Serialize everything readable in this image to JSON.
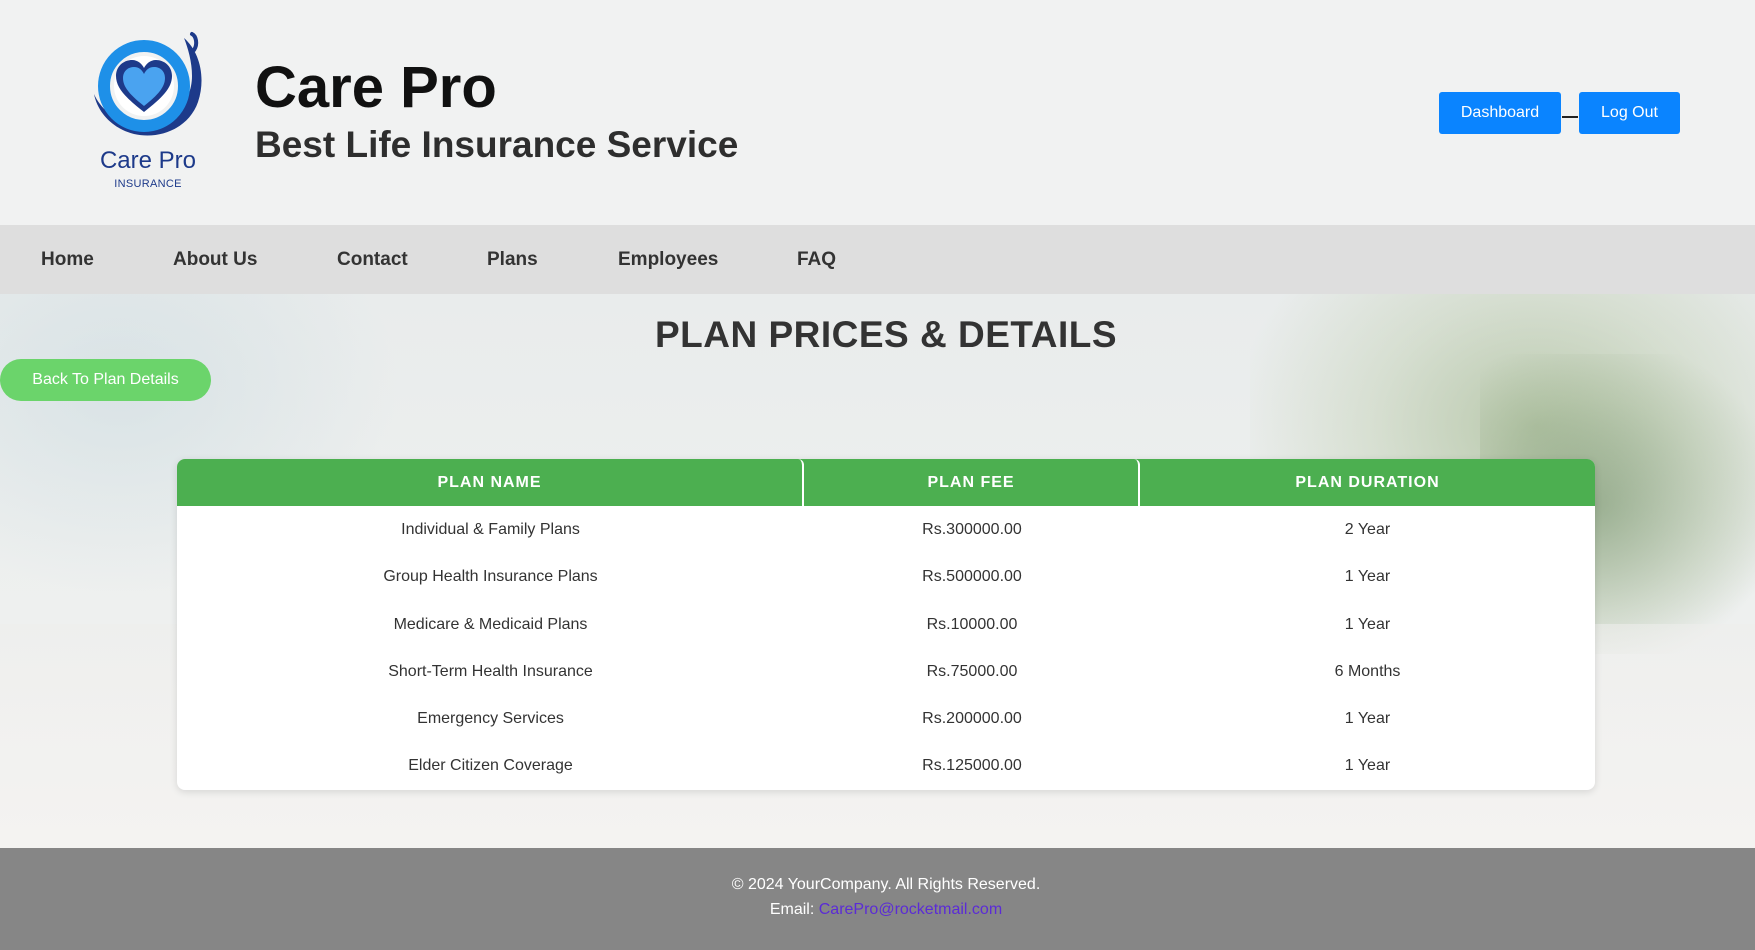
{
  "header": {
    "logo_text": "Care Pro",
    "logo_subtext": "INSURANCE",
    "title": "Care Pro",
    "subtitle": "Best Life Insurance Service",
    "dashboard_label": "Dashboard",
    "logout_label": "Log Out",
    "accent_color": "#0a84ff"
  },
  "nav": {
    "items": [
      {
        "label": "Home"
      },
      {
        "label": "About Us"
      },
      {
        "label": "Contact"
      },
      {
        "label": "Plans"
      },
      {
        "label": "Employees"
      },
      {
        "label": "FAQ"
      }
    ]
  },
  "main": {
    "page_title": "PLAN PRICES & DETAILS",
    "back_label": "Back To Plan Details",
    "back_color": "#6bd46b"
  },
  "table": {
    "header_color": "#4caf50",
    "columns": [
      "PLAN NAME",
      "PLAN FEE",
      "PLAN DURATION"
    ],
    "rows": [
      [
        "Individual & Family Plans",
        "Rs.300000.00",
        "2 Year"
      ],
      [
        "Group Health Insurance Plans",
        "Rs.500000.00",
        "1 Year"
      ],
      [
        "Medicare & Medicaid Plans",
        "Rs.10000.00",
        "1 Year"
      ],
      [
        "Short-Term Health Insurance",
        "Rs.75000.00",
        "6 Months"
      ],
      [
        "Emergency Services",
        "Rs.200000.00",
        "1 Year"
      ],
      [
        "Elder Citizen Coverage",
        "Rs.125000.00",
        "1 Year"
      ]
    ]
  },
  "footer": {
    "copyright": "© 2024 YourCompany. All Rights Reserved.",
    "email_label": "Email: ",
    "email": "CarePro@rocketmail.com"
  }
}
